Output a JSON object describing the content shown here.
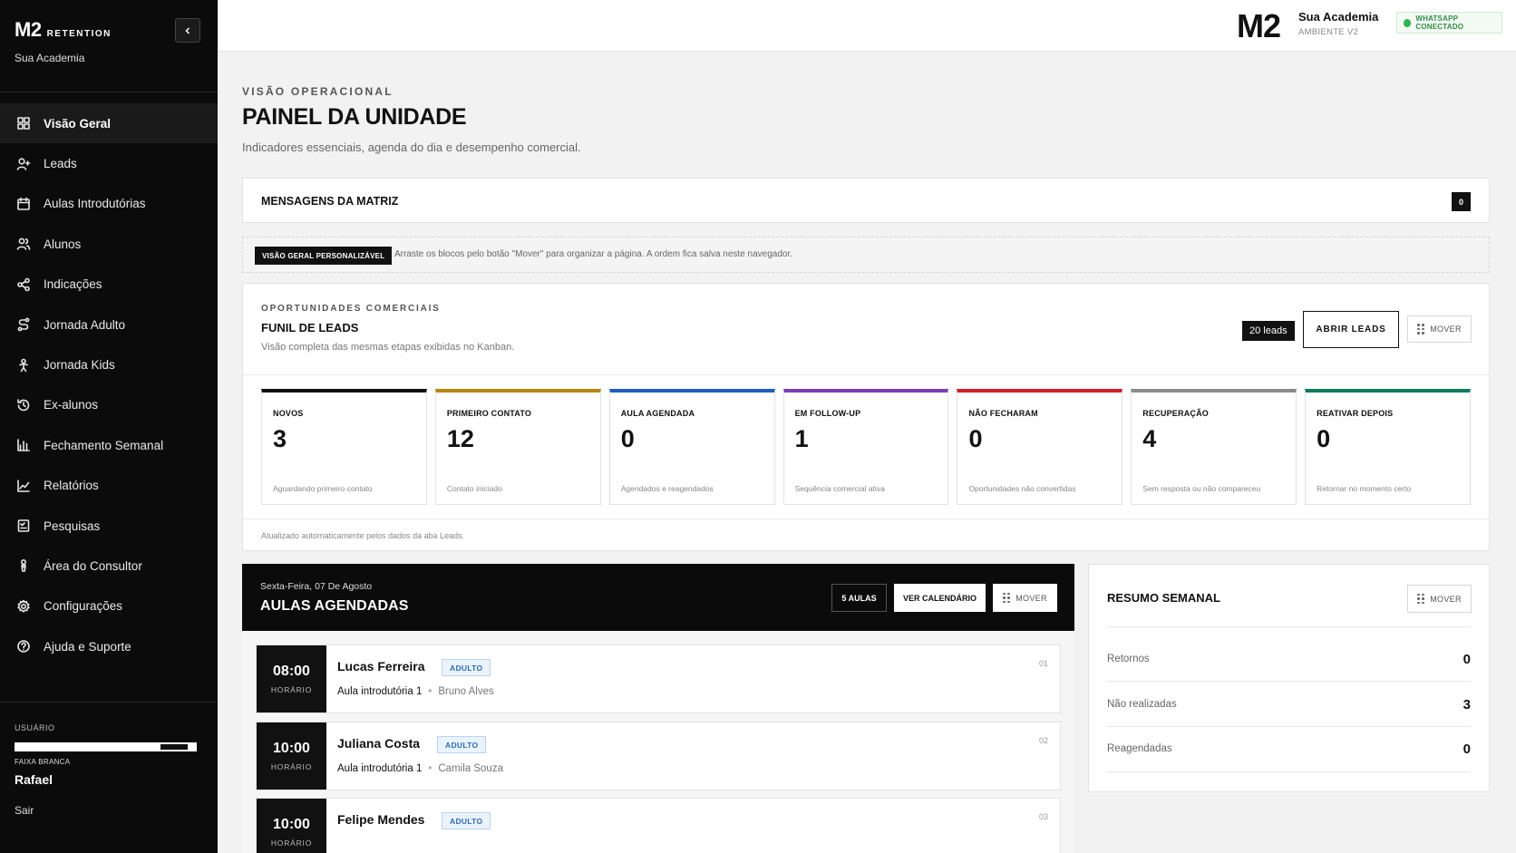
{
  "sidebar": {
    "brand_main": "M2",
    "brand_sub": "RETENTION",
    "academy": "Sua Academia",
    "items": [
      {
        "label": "Visão Geral",
        "icon": "grid-icon",
        "active": true
      },
      {
        "label": "Leads",
        "icon": "user-plus-icon"
      },
      {
        "label": "Aulas Introdutórias",
        "icon": "calendar-icon"
      },
      {
        "label": "Alunos",
        "icon": "users-icon"
      },
      {
        "label": "Indicações",
        "icon": "share-icon"
      },
      {
        "label": "Jornada Adulto",
        "icon": "route-icon"
      },
      {
        "label": "Jornada Kids",
        "icon": "child-icon"
      },
      {
        "label": "Ex-alunos",
        "icon": "history-icon"
      },
      {
        "label": "Fechamento Semanal",
        "icon": "bar-chart-icon"
      },
      {
        "label": "Relatórios",
        "icon": "line-chart-icon"
      },
      {
        "label": "Pesquisas",
        "icon": "checklist-icon"
      },
      {
        "label": "Área do Consultor",
        "icon": "consultant-icon"
      },
      {
        "label": "Configurações",
        "icon": "gear-icon"
      },
      {
        "label": "Ajuda e Suporte",
        "icon": "help-icon"
      }
    ],
    "user_label": "USUÁRIO",
    "belt_label": "FAIXA BRANCA",
    "user_name": "Rafael",
    "logout": "Sair"
  },
  "topbar": {
    "logo": "M2",
    "academy": "Sua Academia",
    "environment": "AMBIENTE V2",
    "whatsapp_status": "WHATSAPP CONECTADO",
    "whatsapp_color": "#2fb351"
  },
  "header": {
    "eyebrow": "VISÃO OPERACIONAL",
    "title": "PAINEL DA UNIDADE",
    "subtitle": "Indicadores essenciais, agenda do dia e desempenho comercial."
  },
  "messages": {
    "title": "MENSAGENS DA MATRIZ",
    "count": "0"
  },
  "note": {
    "tag": "VISÃO GERAL PERSONALIZÁVEL",
    "text": "Arraste os blocos pelo botão \"Mover\" para organizar a página. A ordem fica salva neste navegador."
  },
  "funnel": {
    "eyebrow": "OPORTUNIDADES COMERCIAIS",
    "title": "FUNIL DE LEADS",
    "subtitle": "Visão completa das mesmas etapas exibidas no Kanban.",
    "leads_count": "20 leads",
    "open_button": "ABRIR LEADS",
    "move_button": "MOVER",
    "stages": [
      {
        "name": "NOVOS",
        "count": "3",
        "desc": "Aguardando primeiro contato",
        "color": "#111111"
      },
      {
        "name": "PRIMEIRO CONTATO",
        "count": "12",
        "desc": "Contato iniciado",
        "color": "#b8860b"
      },
      {
        "name": "AULA AGENDADA",
        "count": "0",
        "desc": "Agendados e reagendados",
        "color": "#1f5fbf"
      },
      {
        "name": "EM FOLLOW-UP",
        "count": "1",
        "desc": "Sequência comercial ativa",
        "color": "#7b3fb8"
      },
      {
        "name": "NÃO FECHARAM",
        "count": "0",
        "desc": "Oportunidades não convertidas",
        "color": "#d0202a"
      },
      {
        "name": "RECUPERAÇÃO",
        "count": "4",
        "desc": "Sem resposta ou não compareceu",
        "color": "#8a8a8a"
      },
      {
        "name": "REATIVAR DEPOIS",
        "count": "0",
        "desc": "Retornar no momento certo",
        "color": "#0f7b61"
      }
    ],
    "footer": "Atualizado automaticamente pelos dados da aba Leads."
  },
  "classes": {
    "date": "Sexta-Feira, 07 De Agosto",
    "title": "AULAS AGENDADAS",
    "count_button": "5 AULAS",
    "calendar_button": "VER CALENDÁRIO",
    "move_button": "MOVER",
    "time_label": "HORÁRIO",
    "rows": [
      {
        "time": "08:00",
        "student": "Lucas Ferreira",
        "tag": "ADULTO",
        "class_name": "Aula introdutória 1",
        "teacher": "Bruno Alves",
        "num": "01"
      },
      {
        "time": "10:00",
        "student": "Juliana Costa",
        "tag": "ADULTO",
        "class_name": "Aula introdutória 1",
        "teacher": "Camila Souza",
        "num": "02"
      },
      {
        "time": "10:00",
        "student": "Felipe Mendes",
        "tag": "ADULTO",
        "class_name": "",
        "teacher": "",
        "num": "03"
      }
    ]
  },
  "weekly": {
    "title": "RESUMO SEMANAL",
    "move_button": "MOVER",
    "items": [
      {
        "label": "Retornos",
        "value": "0"
      },
      {
        "label": "Não realizadas",
        "value": "3"
      },
      {
        "label": "Reagendadas",
        "value": "0"
      }
    ]
  }
}
